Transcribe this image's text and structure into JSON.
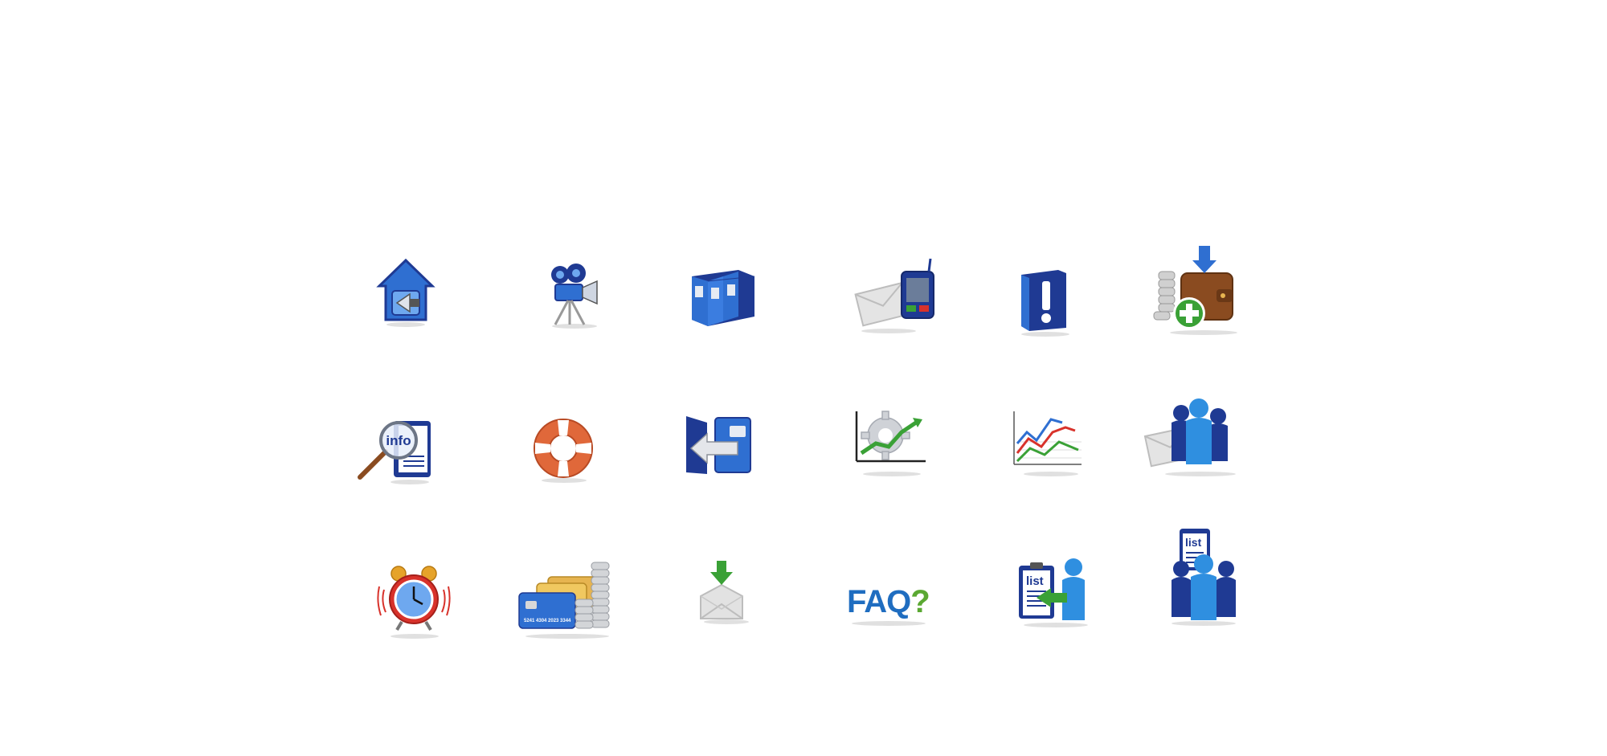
{
  "grid": {
    "rows": [
      {
        "icons": [
          {
            "name": "home-back-icon"
          },
          {
            "name": "movie-camera-icon"
          },
          {
            "name": "archive-binders-icon"
          },
          {
            "name": "mail-mobile-icon"
          },
          {
            "name": "alert-exclamation-icon"
          },
          {
            "name": "wallet-add-funds-icon"
          }
        ]
      },
      {
        "icons": [
          {
            "name": "info-search-icon",
            "label": "info"
          },
          {
            "name": "lifebuoy-help-icon"
          },
          {
            "name": "logout-door-icon"
          },
          {
            "name": "gear-growth-chart-icon"
          },
          {
            "name": "line-chart-icon"
          },
          {
            "name": "group-mail-icon"
          }
        ]
      },
      {
        "icons": [
          {
            "name": "alarm-clock-icon"
          },
          {
            "name": "cards-coins-icon",
            "card_number": "5241 4304 2023 3344"
          },
          {
            "name": "inbox-download-icon"
          },
          {
            "name": "faq-icon",
            "label": "FAQ?"
          },
          {
            "name": "list-user-icon",
            "label": "list"
          },
          {
            "name": "group-list-icon",
            "label": "list"
          }
        ]
      }
    ]
  },
  "colors": {
    "blue_dark": "#1f3a93",
    "blue": "#2f6fd1",
    "blue_light": "#6ea8ef",
    "green": "#3aa136",
    "red": "#d8322b",
    "orange": "#e0683a",
    "gray": "#c9c9c9",
    "brown": "#8a4b20",
    "faq_blue": "#1f6dc0",
    "faq_green": "#5aa832"
  }
}
